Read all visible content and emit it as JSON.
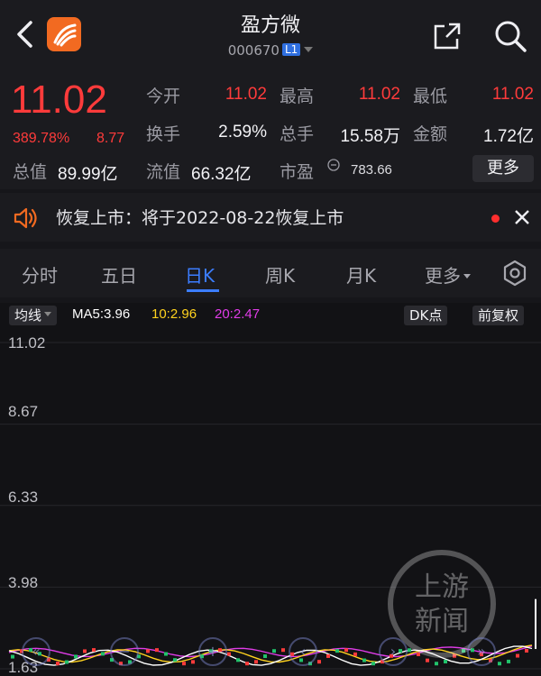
{
  "header": {
    "stock_name": "盈方微",
    "stock_code": "000670",
    "level_badge": "L1"
  },
  "quote": {
    "price": "11.02",
    "change_pct": "389.78%",
    "change_amt": "8.77",
    "open_label": "今开",
    "open_value": "11.02",
    "high_label": "最高",
    "high_value": "11.02",
    "low_label": "最低",
    "low_value": "11.02",
    "turnover_label": "换手",
    "turnover_value": "2.59%",
    "volume_label": "总手",
    "volume_value": "15.58万",
    "amount_label": "金额",
    "amount_value": "1.72亿",
    "total_cap_label": "总值",
    "total_cap_value": "89.99亿",
    "float_cap_label": "流值",
    "float_cap_value": "66.32亿",
    "pe_label": "市盈",
    "pe_value": "783.66",
    "more_label": "更多"
  },
  "notice": {
    "text": "恢复上市：将于2022-08-22恢复上市"
  },
  "tabs": [
    {
      "label": "分时"
    },
    {
      "label": "五日"
    },
    {
      "label": "日K"
    },
    {
      "label": "周K"
    },
    {
      "label": "月K"
    },
    {
      "label": "更多"
    }
  ],
  "indicators": {
    "selector": "均线",
    "ma5": "MA5:3.96",
    "ma10": "10:2.96",
    "ma20": "20:2.47",
    "dk_label": "DK点",
    "adjust_label": "前复权"
  },
  "chart_data": {
    "type": "candlestick",
    "y_ticks": [
      "11.02",
      "8.67",
      "6.33",
      "3.98",
      "1.63"
    ],
    "ylim": [
      1.63,
      11.02
    ],
    "last_close": 11.02,
    "colors": {
      "ma5": "#ffffff",
      "ma10": "#ffd21e",
      "ma20": "#e03ce8",
      "up": "#ff3b3b",
      "down": "#21c26b"
    }
  },
  "watermark": {
    "text_line1": "上游",
    "text_line2": "新闻"
  },
  "icons": [
    "back-arrow-icon",
    "app-logo-icon",
    "share-icon",
    "search-icon",
    "speaker-icon",
    "close-icon",
    "settings-gear-icon"
  ],
  "colors": {
    "up_red": "#ff3b3b",
    "accent_blue": "#3c7dff",
    "logo_orange": "#f26a21"
  }
}
